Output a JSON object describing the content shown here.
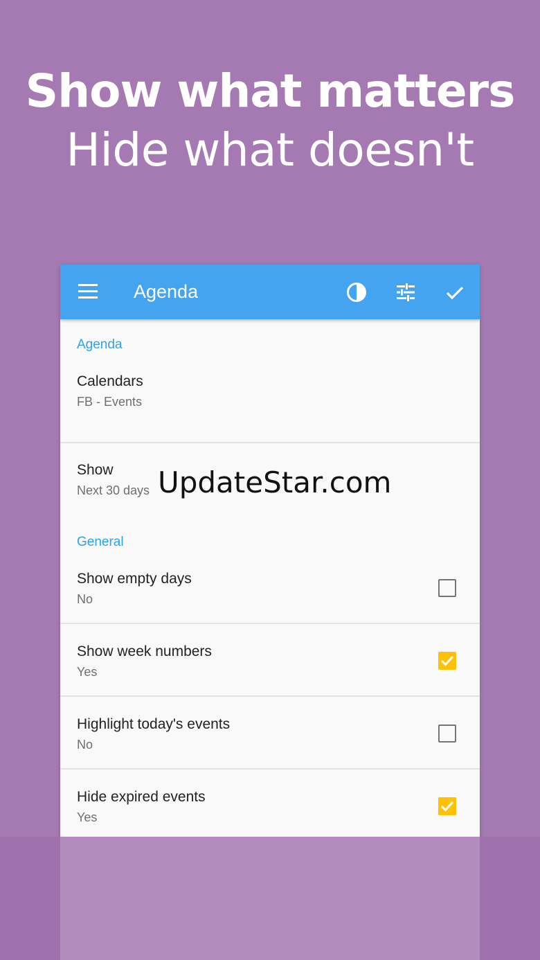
{
  "headline": {
    "line1": "Show what matters",
    "line2": "Hide what doesn't"
  },
  "appbar": {
    "title": "Agenda",
    "icons": [
      "menu-icon",
      "contrast-icon",
      "tune-icon",
      "check-icon"
    ]
  },
  "sections": {
    "agenda_header": "Agenda",
    "general_header": "General"
  },
  "items": {
    "calendars": {
      "title": "Calendars",
      "subtitle": "FB - Events"
    },
    "show": {
      "title": "Show",
      "subtitle": "Next 30 days"
    },
    "empty_days": {
      "title": "Show empty days",
      "subtitle": "No",
      "checked": false
    },
    "week_numbers": {
      "title": "Show week numbers",
      "subtitle": "Yes",
      "checked": true
    },
    "highlight": {
      "title": "Highlight today's events",
      "subtitle": "No",
      "checked": false
    },
    "hide_expired": {
      "title": "Hide expired events",
      "subtitle": "Yes",
      "checked": true
    }
  },
  "watermark": "UpdateStar.com",
  "colors": {
    "background": "#a57ab2",
    "appbar": "#44a4f0",
    "accent": "#2aa3ef",
    "checkbox_checked": "#ffc107"
  }
}
